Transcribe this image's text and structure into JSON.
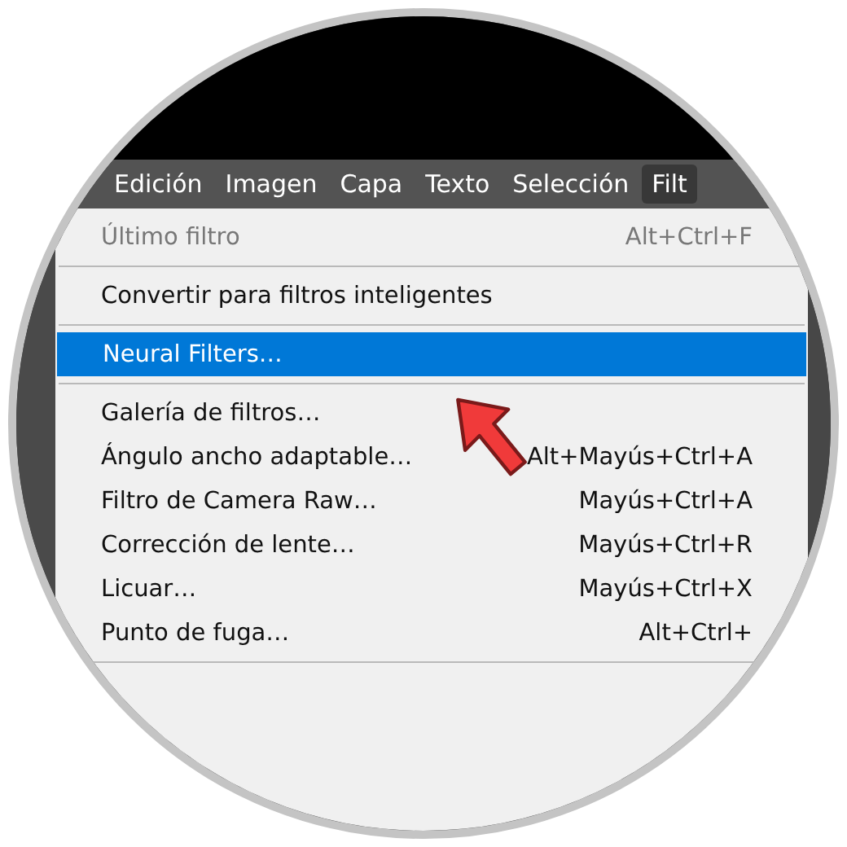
{
  "menu_bar": [
    {
      "label": "Edición",
      "selected": false
    },
    {
      "label": "Imagen",
      "selected": false
    },
    {
      "label": "Capa",
      "selected": false
    },
    {
      "label": "Texto",
      "selected": false
    },
    {
      "label": "Selección",
      "selected": false
    },
    {
      "label": "Filt",
      "selected": true
    }
  ],
  "menu": [
    {
      "kind": "item",
      "label": "Último filtro",
      "shortcut": "Alt+Ctrl+F",
      "disabled": true,
      "selected": false
    },
    {
      "kind": "separator"
    },
    {
      "kind": "item",
      "label": "Convertir para filtros inteligentes",
      "disabled": false,
      "selected": false
    },
    {
      "kind": "separator"
    },
    {
      "kind": "item",
      "label": "Neural Filters…",
      "disabled": false,
      "selected": true
    },
    {
      "kind": "separator"
    },
    {
      "kind": "item",
      "label": "Galería de filtros…",
      "disabled": false,
      "selected": false
    },
    {
      "kind": "item",
      "label": "Ángulo ancho adaptable…",
      "shortcut": "Alt+Mayús+Ctrl+A",
      "disabled": false,
      "selected": false
    },
    {
      "kind": "item",
      "label": "Filtro de Camera Raw…",
      "shortcut": "Mayús+Ctrl+A",
      "disabled": false,
      "selected": false
    },
    {
      "kind": "item",
      "label": "Corrección de lente…",
      "shortcut": "Mayús+Ctrl+R",
      "disabled": false,
      "selected": false
    },
    {
      "kind": "item",
      "label": "Licuar…",
      "shortcut": "Mayús+Ctrl+X",
      "disabled": false,
      "selected": false
    },
    {
      "kind": "item",
      "label": "Punto de fuga…",
      "shortcut": "Alt+Ctrl+",
      "disabled": false,
      "selected": false
    },
    {
      "kind": "separator"
    }
  ]
}
